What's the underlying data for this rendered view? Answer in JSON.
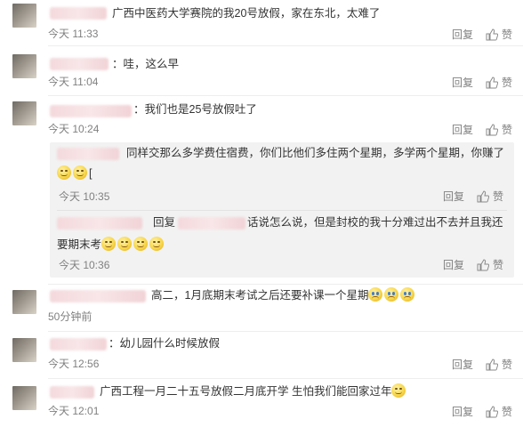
{
  "labels": {
    "reply": "回复",
    "like": "赞"
  },
  "comments": [
    {
      "prefix": "",
      "text": "广西中医药大学赛院的我20号放假，家在东北，太难了",
      "time": "今天 11:33",
      "emojis": []
    },
    {
      "prefix": "",
      "text": "：哇，这么早",
      "time": "今天 11:04",
      "emojis": []
    },
    {
      "prefix": "",
      "text": "：我们也是25号放假吐了",
      "time": "今天 10:24",
      "emojis": []
    },
    {
      "prefix": "",
      "text": "高二，1月底期末考试之后还要补课一个星期",
      "time": "50分钟前",
      "emojis": [
        "cry",
        "cry",
        "cry"
      ]
    },
    {
      "prefix": "",
      "text": "：幼儿园什么时候放假",
      "time": "今天 12:56",
      "emojis": []
    },
    {
      "prefix": "",
      "text": "广西工程一月二十五号放假二月底开学 生怕我们能回家过年",
      "time": "今天 12:01",
      "emojis": [
        "smile"
      ]
    }
  ],
  "replies": [
    {
      "line1": "同样交那么多学费住宿费，你们比他们多住两个星期，多学两个星期，你赚了",
      "line2_trail": "[",
      "time": "今天 10:35"
    },
    {
      "reply_word": "回复",
      "line1_rest": "话说怎么说，但是封校的我十分难过出不去并且我还",
      "line2": "要期末考",
      "time": "今天 10:36"
    }
  ]
}
